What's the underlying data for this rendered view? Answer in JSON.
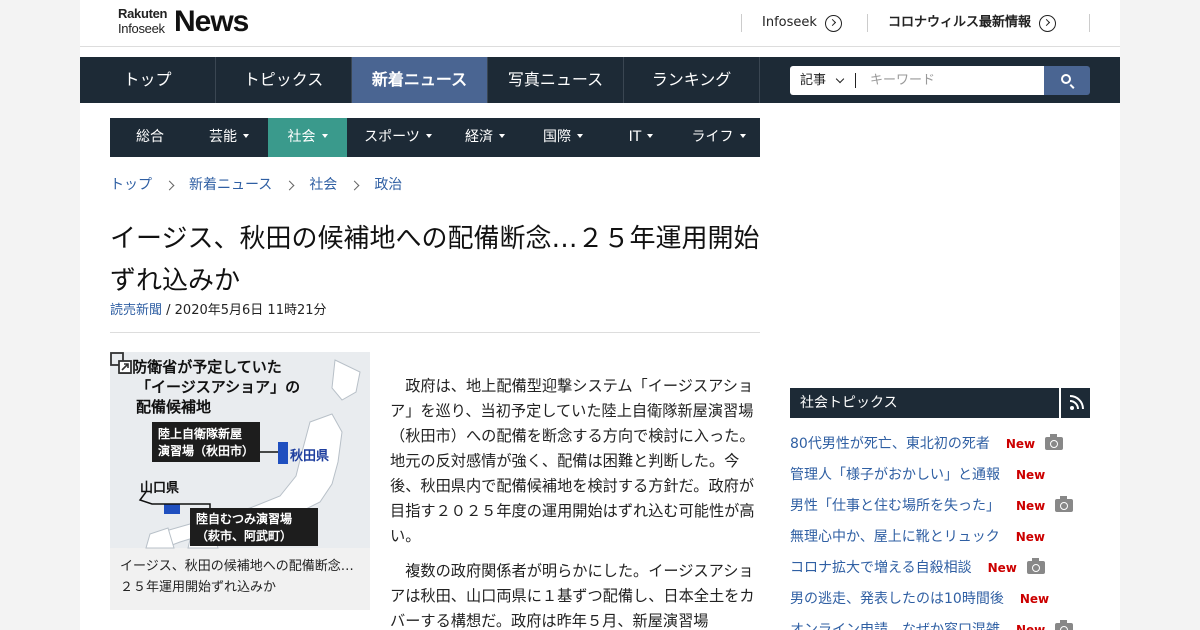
{
  "header": {
    "logo_line1": "Rakuten",
    "logo_line2": "Infoseek",
    "logo_main": "News",
    "links": [
      {
        "label": "Infoseek"
      },
      {
        "label": "コロナウィルス最新情報"
      }
    ]
  },
  "main_nav": {
    "items": [
      {
        "label": "トップ"
      },
      {
        "label": "トピックス"
      },
      {
        "label": "新着ニュース",
        "active": true
      },
      {
        "label": "写真ニュース"
      },
      {
        "label": "ランキング"
      }
    ]
  },
  "search": {
    "scope": "記事",
    "placeholder": "キーワード"
  },
  "category_nav": {
    "items": [
      {
        "label": "総合"
      },
      {
        "label": "芸能"
      },
      {
        "label": "社会",
        "active": true
      },
      {
        "label": "スポーツ"
      },
      {
        "label": "経済"
      },
      {
        "label": "国際"
      },
      {
        "label": "IT"
      },
      {
        "label": "ライフ"
      }
    ]
  },
  "breadcrumb": [
    "トップ",
    "新着ニュース",
    "社会",
    "政治"
  ],
  "article": {
    "title": "イージス、秋田の候補地への配備断念…２５年運用開始ずれ込みか",
    "source": "読売新聞",
    "date": " / 2020年5月6日 11時21分",
    "figure": {
      "map_title_l1": "防衛省が予定していた",
      "map_title_l2": "「イージスアショア」の",
      "map_title_l3": "配備候補地",
      "label_akita_site_l1": "陸上自衛隊新屋",
      "label_akita_site_l2": "演習場（秋田市）",
      "label_akita_pref": "秋田県",
      "label_yamaguchi_pref": "山口県",
      "label_yamaguchi_site_l1": "陸自むつみ演習場",
      "label_yamaguchi_site_l2": "（萩市、阿武町）",
      "caption": "イージス、秋田の候補地への配備断念…２５年運用開始ずれ込みか"
    },
    "paragraphs": [
      "政府は、地上配備型迎撃システム「イージスアショア」を巡り、当初予定していた陸上自衛隊新屋演習場（秋田市）への配備を断念する方向で検討に入った。地元の反対感情が強く、配備は困難と判断した。今後、秋田県内で配備候補地を検討する方針だ。政府が目指す２０２５年度の運用開始はずれ込む可能性が高い。",
      "複数の政府関係者が明らかにした。イージスアショアは秋田、山口両県に１基ずつ配備し、日本全土をカバーする構想だ。政府は昨年５月、新屋演習場"
    ]
  },
  "sidebar": {
    "heading": "社会トピックス",
    "items": [
      {
        "title": "80代男性が死亡、東北初の死者",
        "new": "New",
        "photo": true
      },
      {
        "title": "管理人「様子がおかしい」と通報",
        "new": "New",
        "photo": false
      },
      {
        "title": "男性「仕事と住む場所を失った」",
        "new": "New",
        "photo": true
      },
      {
        "title": "無理心中か、屋上に靴とリュック",
        "new": "New",
        "photo": false
      },
      {
        "title": "コロナ拡大で増える自殺相談",
        "new": "New",
        "photo": true
      },
      {
        "title": "男の逃走、発表したのは10時間後",
        "new": "New",
        "photo": false
      },
      {
        "title": "オンライン申請、なぜか窓口混雑",
        "new": "New",
        "photo": true
      }
    ]
  },
  "colors": {
    "nav_dark": "#1d2a36",
    "nav_active": "#4a6592",
    "category_active": "#3a9a8c",
    "link": "#2f5fa3",
    "new_badge": "#cc0000"
  }
}
